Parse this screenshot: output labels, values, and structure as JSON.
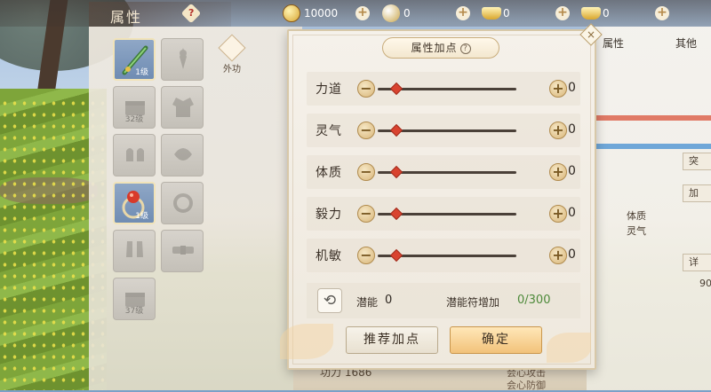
{
  "header": {
    "title": "属性",
    "help_label": "?",
    "currencies": [
      {
        "icon": "copper-coin-icon",
        "value": "10000"
      },
      {
        "icon": "gold-coin-icon",
        "value": "0"
      },
      {
        "icon": "gold-ingot-icon",
        "value": "0"
      },
      {
        "icon": "silver-ingot-icon",
        "value": "0"
      }
    ],
    "plus_label": "+"
  },
  "equipment": {
    "slots": [
      {
        "icon": "jade-sword-icon",
        "level": "1级",
        "filled": true
      },
      {
        "icon": "hairpin-icon",
        "level": "",
        "filled": false
      },
      {
        "icon": "chest-icon",
        "level": "32级",
        "filled": false
      },
      {
        "icon": "robe-icon",
        "level": "",
        "filled": false
      },
      {
        "icon": "gloves-icon",
        "level": "",
        "filled": false
      },
      {
        "icon": "leaf-ornament-icon",
        "level": "",
        "filled": false
      },
      {
        "icon": "red-gem-ring-icon",
        "level": "1级",
        "filled": true
      },
      {
        "icon": "ring-icon",
        "level": "",
        "filled": false
      },
      {
        "icon": "boots-icon",
        "level": "",
        "filled": false
      },
      {
        "icon": "belt-icon",
        "level": "",
        "filled": false
      },
      {
        "icon": "chest-icon",
        "level": "37级",
        "filled": false
      }
    ],
    "waigong_label": "外功"
  },
  "dialog": {
    "title": "属性加点",
    "help_label": "?",
    "attributes": [
      {
        "label": "力道",
        "value": "0"
      },
      {
        "label": "灵气",
        "value": "0"
      },
      {
        "label": "体质",
        "value": "0"
      },
      {
        "label": "毅力",
        "value": "0"
      },
      {
        "label": "机敏",
        "value": "0"
      }
    ],
    "minus_label": "−",
    "plus_label": "+",
    "potential_label": "潜能",
    "potential_value": "0",
    "talisman_label": "潜能符增加",
    "talisman_value": "0/300",
    "recommend_label": "推荐加点",
    "confirm_label": "确定"
  },
  "right_panel": {
    "header_1": "属性",
    "header_2": "其他",
    "btn_breakthrough": "突",
    "btn_add": "加",
    "stat_1": "体质",
    "stat_2": "灵气",
    "btn_detail": "详",
    "value_1": "90"
  },
  "bottom": {
    "combat_label": "功力",
    "combat_value": "1686",
    "item_1": "会心攻击",
    "item_2": "会心防御"
  },
  "colors": {
    "accent_red": "#d9432f",
    "talisman_green": "#4d8a3a",
    "confirm_gold": "#f2c27a"
  }
}
